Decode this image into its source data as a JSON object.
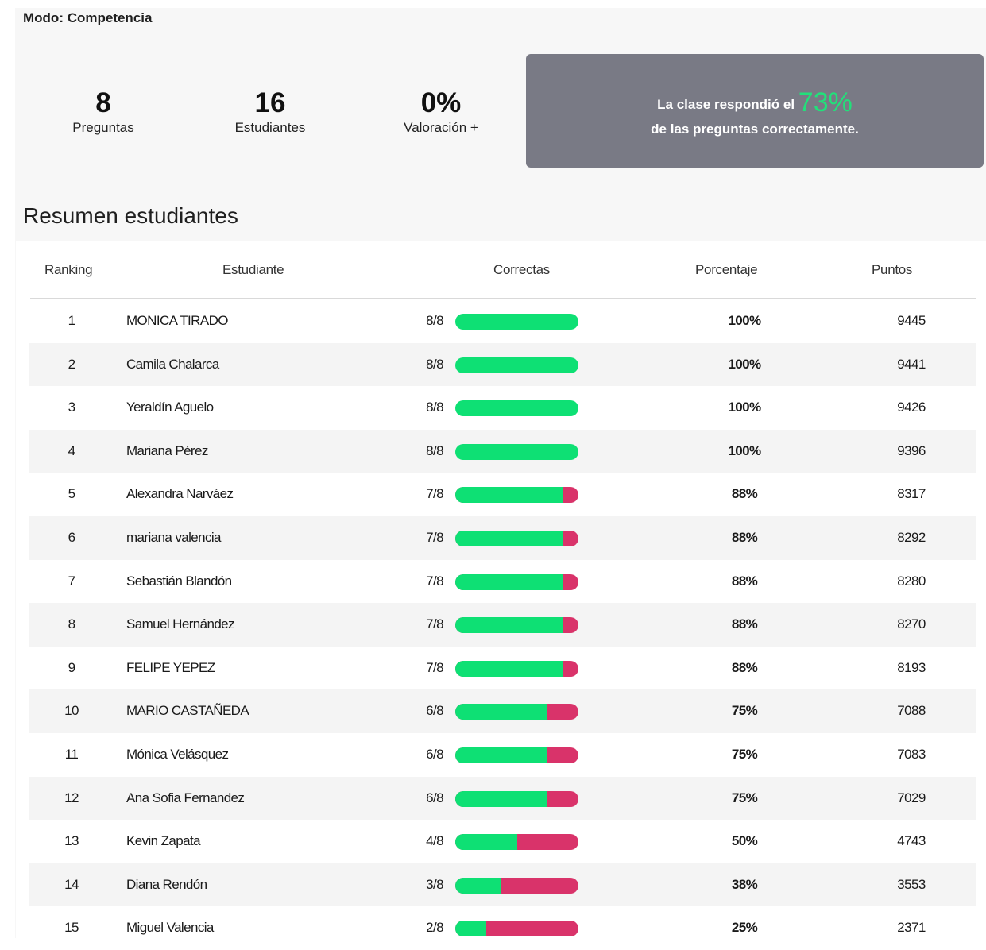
{
  "mode_label": "Modo: Competencia",
  "stats": {
    "questions": {
      "value": "8",
      "label": "Preguntas"
    },
    "students": {
      "value": "16",
      "label": "Estudiantes"
    },
    "rating": {
      "value": "0%",
      "label": "Valoración +"
    }
  },
  "banner": {
    "prefix": "La clase respondió el",
    "percent": "73%",
    "suffix": "de las preguntas correctamente."
  },
  "section_title": "Resumen estudiantes",
  "table": {
    "headers": {
      "ranking": "Ranking",
      "student": "Estudiante",
      "correct": "Correctas",
      "percentage": "Porcentaje",
      "points": "Puntos"
    },
    "rows": [
      {
        "rank": "1",
        "name": "MONICA TIRADO",
        "correct": "8/8",
        "fraction": 1.0,
        "percent": "100%",
        "points": "9445"
      },
      {
        "rank": "2",
        "name": "Camila Chalarca",
        "correct": "8/8",
        "fraction": 1.0,
        "percent": "100%",
        "points": "9441"
      },
      {
        "rank": "3",
        "name": "Yeraldín Aguelo",
        "correct": "8/8",
        "fraction": 1.0,
        "percent": "100%",
        "points": "9426"
      },
      {
        "rank": "4",
        "name": "Mariana Pérez",
        "correct": "8/8",
        "fraction": 1.0,
        "percent": "100%",
        "points": "9396"
      },
      {
        "rank": "5",
        "name": "Alexandra Narváez",
        "correct": "7/8",
        "fraction": 0.875,
        "percent": "88%",
        "points": "8317"
      },
      {
        "rank": "6",
        "name": "mariana valencia",
        "correct": "7/8",
        "fraction": 0.875,
        "percent": "88%",
        "points": "8292"
      },
      {
        "rank": "7",
        "name": "Sebastián Blandón",
        "correct": "7/8",
        "fraction": 0.875,
        "percent": "88%",
        "points": "8280"
      },
      {
        "rank": "8",
        "name": "Samuel Hernández",
        "correct": "7/8",
        "fraction": 0.875,
        "percent": "88%",
        "points": "8270"
      },
      {
        "rank": "9",
        "name": "FELIPE YEPEZ",
        "correct": "7/8",
        "fraction": 0.875,
        "percent": "88%",
        "points": "8193"
      },
      {
        "rank": "10",
        "name": "MARIO CASTAÑEDA",
        "correct": "6/8",
        "fraction": 0.75,
        "percent": "75%",
        "points": "7088"
      },
      {
        "rank": "11",
        "name": "Mónica Velásquez",
        "correct": "6/8",
        "fraction": 0.75,
        "percent": "75%",
        "points": "7083"
      },
      {
        "rank": "12",
        "name": "Ana Sofia Fernandez",
        "correct": "6/8",
        "fraction": 0.75,
        "percent": "75%",
        "points": "7029"
      },
      {
        "rank": "13",
        "name": "Kevin Zapata",
        "correct": "4/8",
        "fraction": 0.5,
        "percent": "50%",
        "points": "4743"
      },
      {
        "rank": "14",
        "name": "Diana Rendón",
        "correct": "3/8",
        "fraction": 0.375,
        "percent": "38%",
        "points": "3553"
      },
      {
        "rank": "15",
        "name": "Miguel Valencia",
        "correct": "2/8",
        "fraction": 0.25,
        "percent": "25%",
        "points": "2371"
      }
    ]
  },
  "colors": {
    "correct": "#0ee074",
    "incorrect": "#d9336a",
    "banner_bg": "#797a85",
    "banner_accent": "#22e07a"
  }
}
